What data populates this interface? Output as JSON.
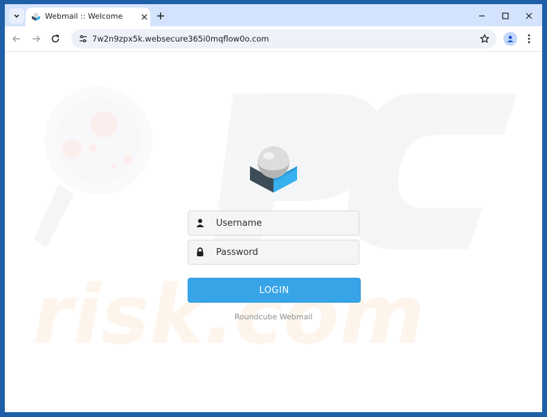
{
  "browser": {
    "tab": {
      "title": "Webmail :: Welcome"
    },
    "url": "7w2n9zpx5k.websecure365i0mqflow0o.com",
    "icons": {
      "tab_search": "chevron-down-icon",
      "tab_close": "close-icon",
      "new_tab": "plus-icon",
      "minimize": "minimize-icon",
      "maximize": "maximize-icon",
      "close": "close-icon",
      "back": "arrow-left-icon",
      "forward": "arrow-right-icon",
      "reload": "reload-icon",
      "site_info": "tune-icon",
      "bookmark": "star-icon",
      "profile": "person-icon",
      "menu": "kebab-menu-icon"
    }
  },
  "login": {
    "username_placeholder": "Username",
    "password_placeholder": "Password",
    "submit_label": "LOGIN",
    "footer": "Roundcube Webmail"
  },
  "colors": {
    "login_button": "#37a4e8",
    "tabstrip": "#d3e3fd",
    "window_frame": "#1f5fa8"
  }
}
